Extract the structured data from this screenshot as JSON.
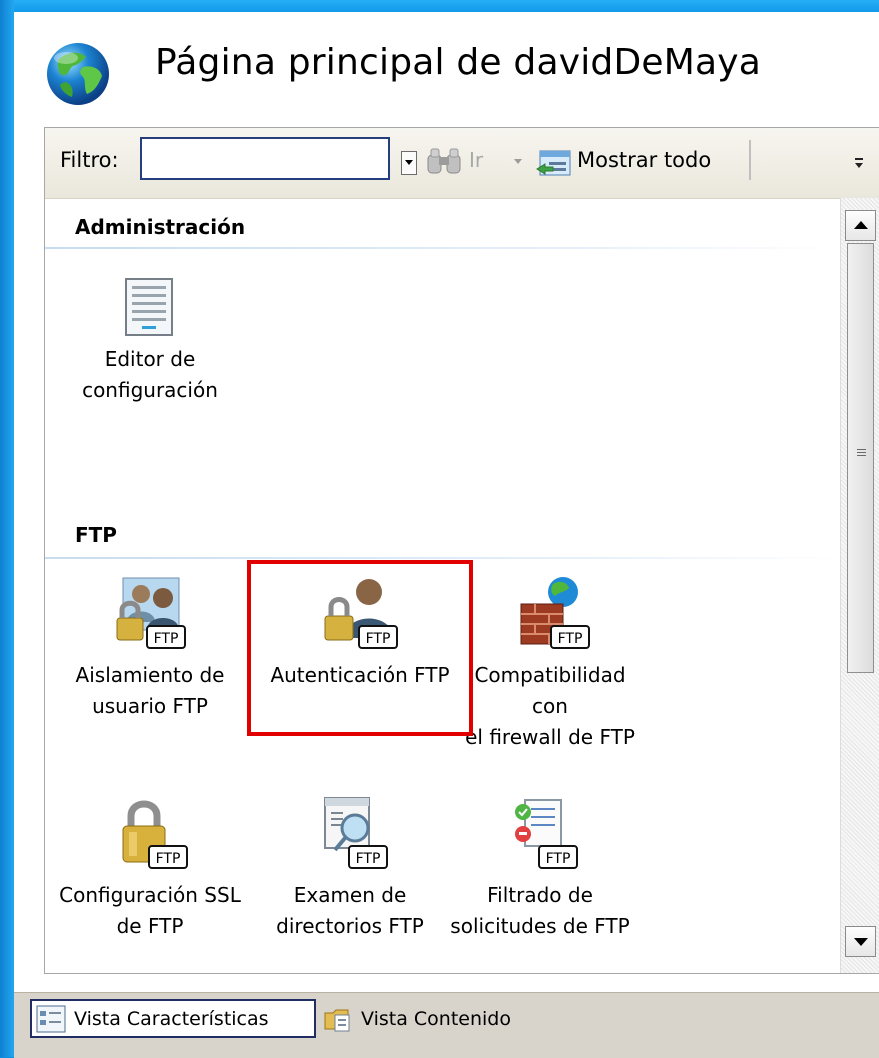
{
  "header": {
    "title": "Página principal de davidDeMaya",
    "icon": "globe-icon"
  },
  "toolbar": {
    "filter_label": "Filtro:",
    "filter_value": "",
    "go_label": "Ir",
    "show_all_label": "Mostrar todo"
  },
  "sections": [
    {
      "title": "Administración",
      "features": [
        {
          "label": "Editor de\nconfiguración",
          "icon": "config-editor-icon"
        }
      ]
    },
    {
      "title": "FTP",
      "features": [
        {
          "label": "Aislamiento de\nusuario FTP",
          "icon": "ftp-user-isolation-icon"
        },
        {
          "label": "Autenticación FTP",
          "icon": "ftp-authentication-icon",
          "selected": true
        },
        {
          "label": "Compatibilidad con\nel firewall de FTP",
          "icon": "ftp-firewall-icon"
        },
        {
          "label": "Configuración SSL\nde FTP",
          "icon": "ftp-ssl-icon"
        },
        {
          "label": "Examen de\ndirectorios FTP",
          "icon": "ftp-directory-browsing-icon"
        },
        {
          "label": "Filtrado de\nsolicitudes de FTP",
          "icon": "ftp-request-filtering-icon"
        }
      ]
    }
  ],
  "view_tabs": {
    "features": "Vista Características",
    "content": "Vista Contenido",
    "active": "features"
  },
  "colors": {
    "frame_blue": "#0b8fe0",
    "selection_red": "#e00000",
    "filter_border": "#253f7e"
  }
}
